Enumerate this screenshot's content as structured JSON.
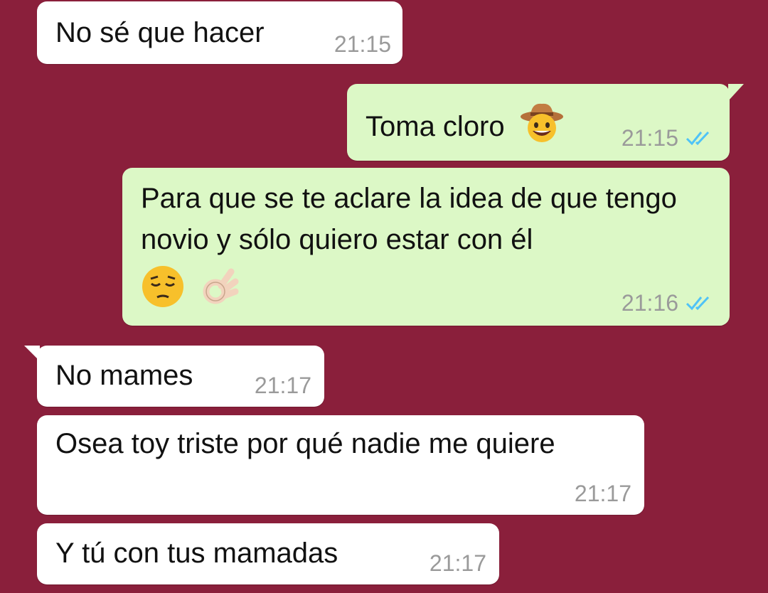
{
  "messages": [
    {
      "text": "No sé que hacer",
      "time": "21:15",
      "direction": "incoming"
    },
    {
      "text": "Toma cloro",
      "time": "21:15",
      "direction": "outgoing",
      "emojis": [
        "cowboy-face-emoji"
      ],
      "read": true
    },
    {
      "text": "Para que se te aclare la idea de que tengo novio y sólo quiero estar con él",
      "time": "21:16",
      "direction": "outgoing",
      "emojis": [
        "pensive-face-emoji",
        "ok-hand-emoji"
      ],
      "read": true
    },
    {
      "text": "No mames",
      "time": "21:17",
      "direction": "incoming"
    },
    {
      "text": "Osea toy triste por qué nadie me quiere",
      "time": "21:17",
      "direction": "incoming"
    },
    {
      "text": "Y tú con tus mamadas",
      "time": "21:17",
      "direction": "incoming"
    }
  ],
  "colors": {
    "background": "#8a1f3b",
    "incoming_bubble": "#ffffff",
    "outgoing_bubble": "#dcf8c6",
    "read_checks": "#4fc3f7",
    "timestamp": "#9a9a9a"
  }
}
